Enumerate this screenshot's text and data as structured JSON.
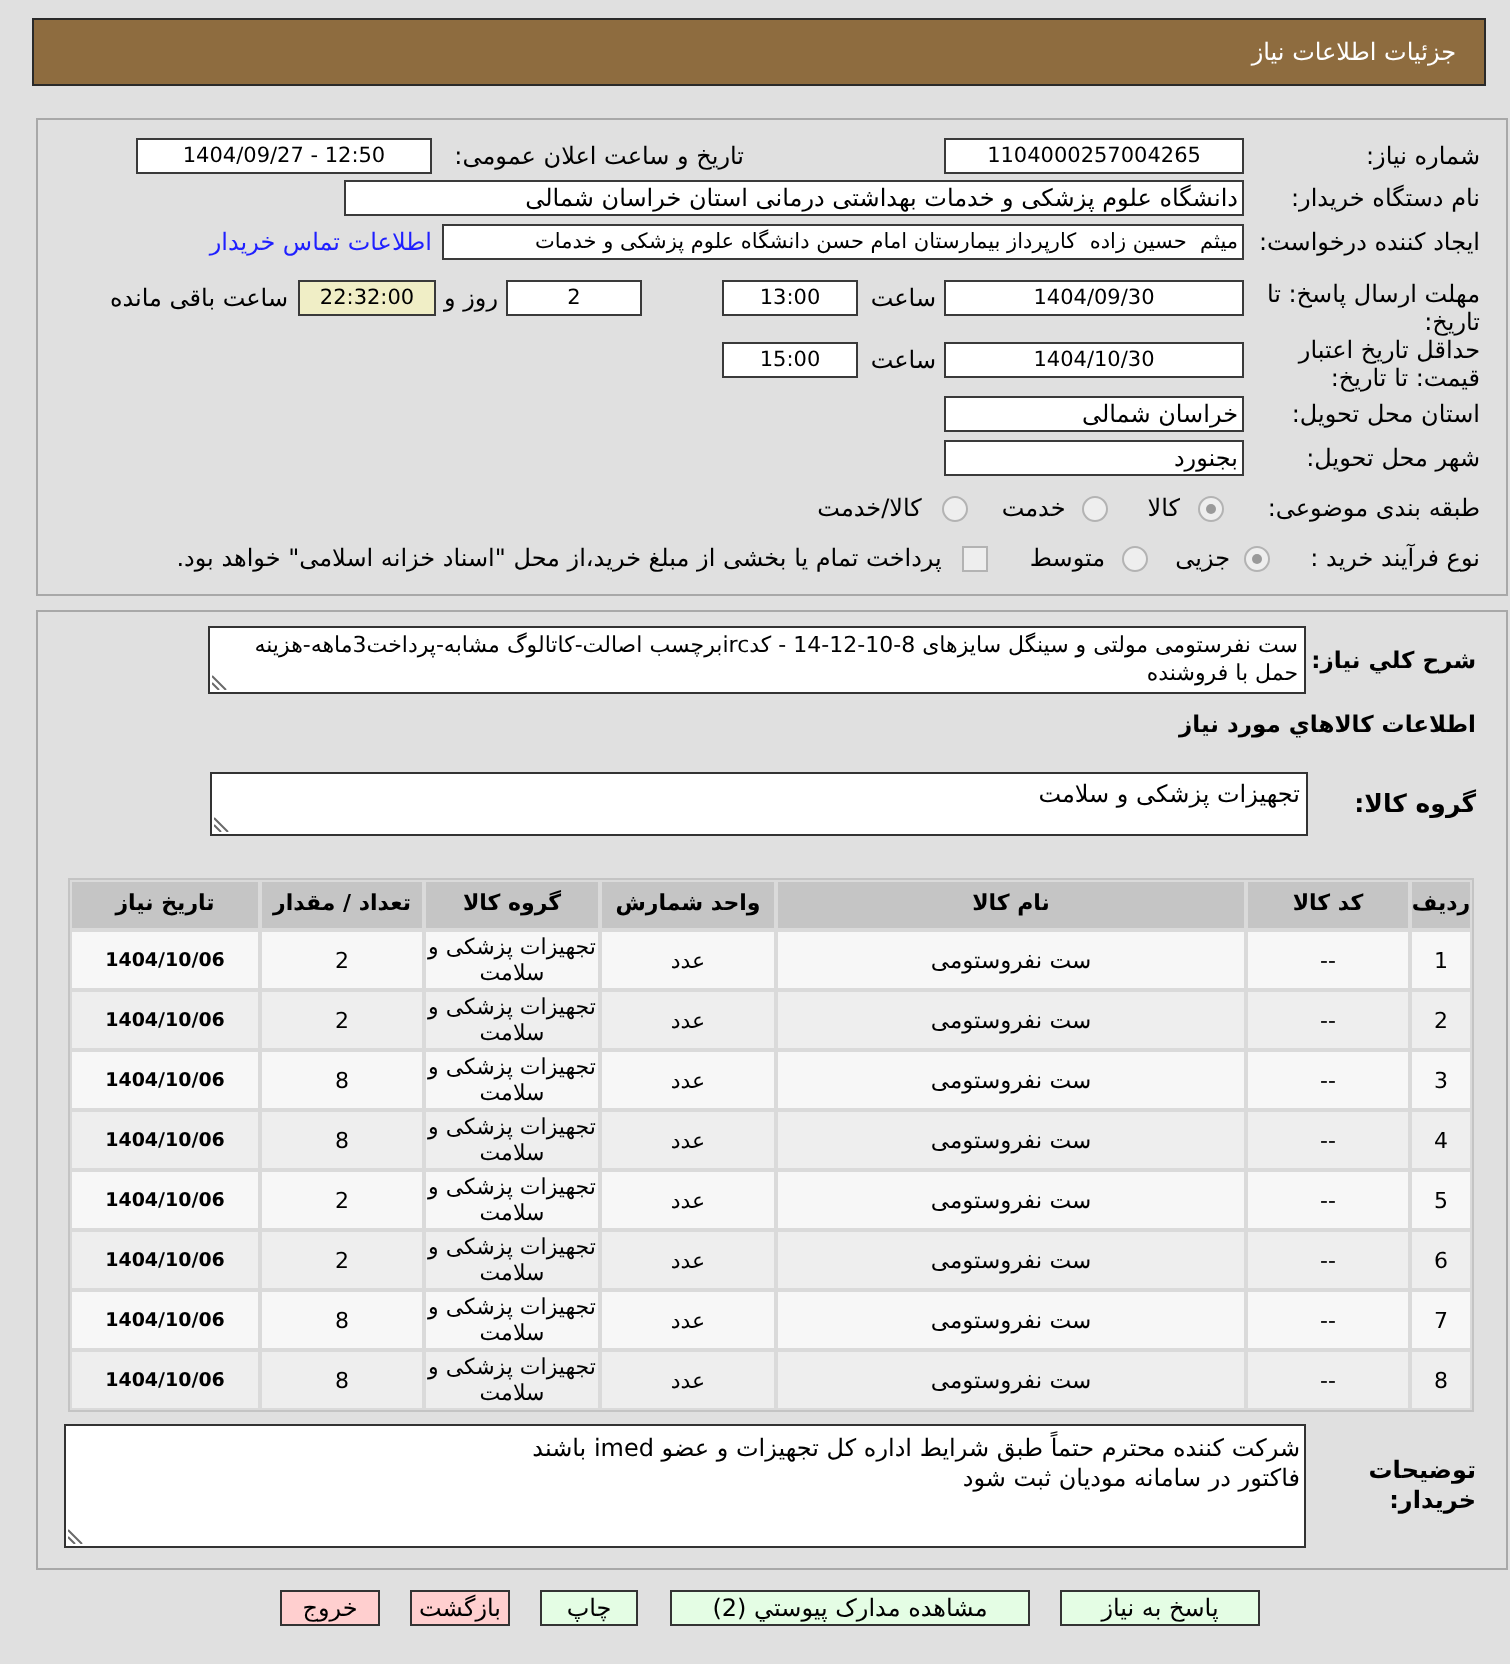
{
  "header": {
    "title": "جزئیات اطلاعات نیاز"
  },
  "details": {
    "need_number": {
      "label": "شماره نیاز:",
      "value": "1104000257004265"
    },
    "announce": {
      "label": "تاریخ و ساعت اعلان عمومی:",
      "value": "1404/09/27 - 12:50"
    },
    "buyer_org": {
      "label": "نام دستگاه خریدار:",
      "value": "دانشگاه علوم پزشکی و خدمات بهداشتی درمانی استان خراسان شمالی"
    },
    "requester": {
      "label": "ایجاد کننده درخواست:",
      "value": "میثم  حسین زاده  کارپرداز بیمارستان امام حسن دانشگاه علوم پزشکی و خدمات",
      "contact_link": "اطلاعات تماس خریدار"
    },
    "reply_deadline": {
      "label": "مهلت ارسال پاسخ: تا تاریخ:",
      "date": "1404/09/30",
      "time_label": "ساعت",
      "time": "13:00",
      "days": "2",
      "days_label": "روز و",
      "remaining": "22:32:00",
      "remaining_label": "ساعت باقی مانده"
    },
    "price_validity": {
      "label": "حداقل تاریخ اعتبار قیمت: تا تاریخ:",
      "date": "1404/10/30",
      "time_label": "ساعت",
      "time": "15:00"
    },
    "delivery_province": {
      "label": "استان محل تحویل:",
      "value": "خراسان شمالی"
    },
    "delivery_city": {
      "label": "شهر محل تحویل:",
      "value": "بجنورد"
    },
    "category": {
      "label": "طبقه بندی موضوعی:",
      "options": [
        {
          "label": "کالا",
          "selected": true
        },
        {
          "label": "خدمت",
          "selected": false
        },
        {
          "label": "کالا/خدمت",
          "selected": false
        }
      ]
    },
    "purchase_process": {
      "label": "نوع فرآیند خرید :",
      "options": [
        {
          "label": "جزیی",
          "selected": true
        },
        {
          "label": "متوسط",
          "selected": false
        }
      ],
      "treasury_payment": {
        "label": "پرداخت تمام یا بخشی از مبلغ خرید،از محل \"اسناد خزانه اسلامی\" خواهد بود.",
        "checked": false
      }
    }
  },
  "description": {
    "label": "شرح کلي نياز:",
    "value": "ست نفرستومی مولتی و سینگل سایزهای 8-10-12-14 - کدircبرچسب اصالت-کاتالوگ مشابه-پرداخت3ماهه-هزینه حمل با فروشنده"
  },
  "goods_heading": "اطلاعات کالاهاي مورد نياز",
  "goods_group": {
    "label": "گروه کالا:",
    "value": "تجهیزات پزشکی و سلامت"
  },
  "table": {
    "columns": [
      "ردیف",
      "کد کالا",
      "نام کالا",
      "واحد شمارش",
      "گروه کالا",
      "تعداد / مقدار",
      "تاریخ نیاز"
    ],
    "rows": [
      [
        "1",
        "--",
        "ست نفروستومی",
        "عدد",
        "تجهیزات پزشکی و سلامت",
        "2",
        "1404/10/06"
      ],
      [
        "2",
        "--",
        "ست نفروستومی",
        "عدد",
        "تجهیزات پزشکی و سلامت",
        "2",
        "1404/10/06"
      ],
      [
        "3",
        "--",
        "ست نفروستومی",
        "عدد",
        "تجهیزات پزشکی و سلامت",
        "8",
        "1404/10/06"
      ],
      [
        "4",
        "--",
        "ست نفروستومی",
        "عدد",
        "تجهیزات پزشکی و سلامت",
        "8",
        "1404/10/06"
      ],
      [
        "5",
        "--",
        "ست نفروستومی",
        "عدد",
        "تجهیزات پزشکی و سلامت",
        "2",
        "1404/10/06"
      ],
      [
        "6",
        "--",
        "ست نفروستومی",
        "عدد",
        "تجهیزات پزشکی و سلامت",
        "2",
        "1404/10/06"
      ],
      [
        "7",
        "--",
        "ست نفروستومی",
        "عدد",
        "تجهیزات پزشکی و سلامت",
        "8",
        "1404/10/06"
      ],
      [
        "8",
        "--",
        "ست نفروستومی",
        "عدد",
        "تجهیزات پزشکی و سلامت",
        "8",
        "1404/10/06"
      ]
    ]
  },
  "buyer_notes": {
    "label": "توضیحات خریدار:",
    "lines": [
      "شرکت کننده محترم حتماً طبق شرایط اداره کل تجهیزات و عضو imed باشند",
      "فاکتور در سامانه مودیان ثبت شود"
    ]
  },
  "buttons": [
    {
      "label": "پاسخ به نیاز",
      "kind": "positive"
    },
    {
      "label": "مشاهده مدارک پیوستي (2)",
      "kind": "positive"
    },
    {
      "label": "چاپ",
      "kind": "positive"
    },
    {
      "label": "بازگشت",
      "kind": "negative"
    },
    {
      "label": "خروج",
      "kind": "negative"
    }
  ]
}
